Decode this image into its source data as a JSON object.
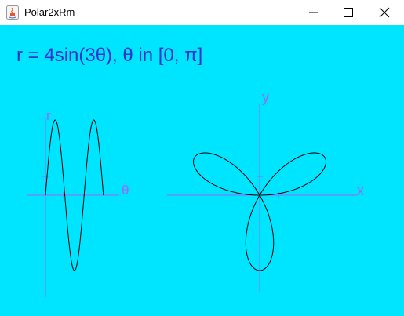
{
  "window": {
    "title": "Polar2xRm",
    "controls": [
      "minimize",
      "maximize",
      "close"
    ]
  },
  "equation": "r = 4sin(3θ), θ in [0, π]",
  "colors": {
    "background": "#00e5ff",
    "axis": "#9966ff",
    "axis_label": "#9966ff",
    "curve": "#000000",
    "equation": "#3333cc"
  },
  "chart_data": [
    {
      "type": "line",
      "title": "",
      "xlabel": "θ",
      "ylabel": "r",
      "function": "r = 4sin(3θ)",
      "xlim": [
        0,
        3.1416
      ],
      "ylim": [
        -4,
        4
      ],
      "series": [
        {
          "x": [
            0,
            0.2618,
            0.5236,
            0.7854,
            1.0472,
            1.309,
            1.5708,
            1.8326,
            2.0944,
            2.3562,
            2.618,
            2.8798,
            3.1416
          ],
          "values": [
            0,
            2.83,
            4,
            2.83,
            0,
            -2.83,
            -4,
            -2.83,
            0,
            2.83,
            4,
            2.83,
            0
          ]
        }
      ]
    },
    {
      "type": "line",
      "title": "",
      "xlabel": "x",
      "ylabel": "y",
      "function": "r = 4sin(3θ) polar rose",
      "xlim": [
        -4,
        4
      ],
      "ylim": [
        -4,
        4
      ],
      "series": [
        {
          "x": [
            0,
            0.71,
            1.73,
            2.0,
            0,
            -2.0,
            -1.73,
            -0.71,
            0
          ],
          "values": [
            0,
            0.71,
            1.0,
            2.0,
            0,
            2.0,
            1.0,
            0.71,
            0
          ]
        }
      ]
    }
  ]
}
